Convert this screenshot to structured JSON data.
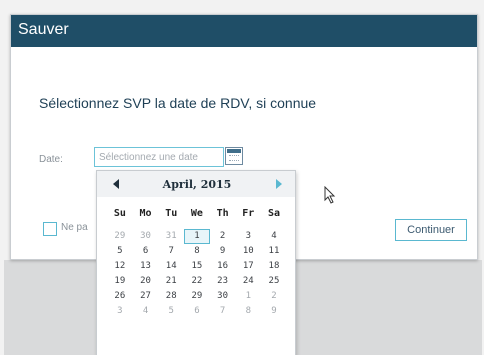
{
  "dialog": {
    "title": "Sauver",
    "prompt": "Sélectionnez SVP la date de RDV, si connue",
    "date_label": "Date:",
    "date_placeholder": "Sélectionnez une date",
    "checkbox_label": "Ne pa",
    "continue_label": "Continuer"
  },
  "calendar": {
    "month_label": "April, 2015",
    "weekdays": [
      "Su",
      "Mo",
      "Tu",
      "We",
      "Th",
      "Fr",
      "Sa"
    ],
    "weeks": [
      [
        {
          "d": "29",
          "o": true
        },
        {
          "d": "30",
          "o": true
        },
        {
          "d": "31",
          "o": true
        },
        {
          "d": "1",
          "o": false,
          "sel": true
        },
        {
          "d": "2",
          "o": false
        },
        {
          "d": "3",
          "o": false
        },
        {
          "d": "4",
          "o": false
        }
      ],
      [
        {
          "d": "5",
          "o": false
        },
        {
          "d": "6",
          "o": false
        },
        {
          "d": "7",
          "o": false
        },
        {
          "d": "8",
          "o": false
        },
        {
          "d": "9",
          "o": false
        },
        {
          "d": "10",
          "o": false
        },
        {
          "d": "11",
          "o": false
        }
      ],
      [
        {
          "d": "12",
          "o": false
        },
        {
          "d": "13",
          "o": false
        },
        {
          "d": "14",
          "o": false
        },
        {
          "d": "15",
          "o": false
        },
        {
          "d": "16",
          "o": false
        },
        {
          "d": "17",
          "o": false
        },
        {
          "d": "18",
          "o": false
        }
      ],
      [
        {
          "d": "19",
          "o": false
        },
        {
          "d": "20",
          "o": false
        },
        {
          "d": "21",
          "o": false
        },
        {
          "d": "22",
          "o": false
        },
        {
          "d": "23",
          "o": false
        },
        {
          "d": "24",
          "o": false
        },
        {
          "d": "25",
          "o": false
        }
      ],
      [
        {
          "d": "26",
          "o": false
        },
        {
          "d": "27",
          "o": false
        },
        {
          "d": "28",
          "o": false
        },
        {
          "d": "29",
          "o": false
        },
        {
          "d": "30",
          "o": false
        },
        {
          "d": "1",
          "o": true
        },
        {
          "d": "2",
          "o": true
        }
      ],
      [
        {
          "d": "3",
          "o": true
        },
        {
          "d": "4",
          "o": true
        },
        {
          "d": "5",
          "o": true
        },
        {
          "d": "6",
          "o": true
        },
        {
          "d": "7",
          "o": true
        },
        {
          "d": "8",
          "o": true
        },
        {
          "d": "9",
          "o": true
        }
      ]
    ]
  },
  "icons": {
    "calendar": "calendar-icon",
    "prev": "chevron-left-icon",
    "next": "chevron-right-icon",
    "cursor": "mouse-pointer-icon"
  },
  "colors": {
    "titlebar": "#1f4e67",
    "accent": "#5ab8d0",
    "prompt_text": "#1e3f55"
  }
}
